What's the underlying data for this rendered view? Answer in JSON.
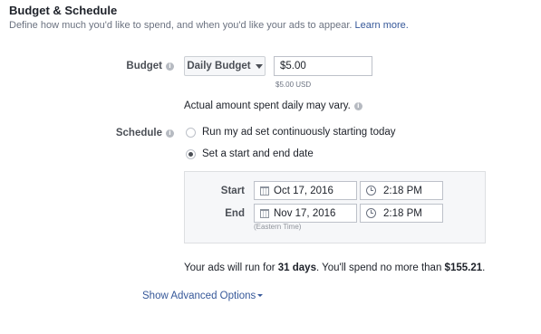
{
  "section": {
    "title": "Budget & Schedule",
    "subtitle": "Define how much you'd like to spend, and when you'd like your ads to appear.",
    "learn_more": "Learn more."
  },
  "budget": {
    "label": "Budget",
    "type_selected": "Daily Budget",
    "amount": "$5.00",
    "currency_hint": "$5.00 USD",
    "note": "Actual amount spent daily may vary."
  },
  "schedule": {
    "label": "Schedule",
    "options": [
      {
        "label": "Run my ad set continuously starting today",
        "selected": false
      },
      {
        "label": "Set a start and end date",
        "selected": true
      }
    ],
    "start": {
      "label": "Start",
      "date": "Oct 17, 2016",
      "time": "2:18 PM"
    },
    "end": {
      "label": "End",
      "date": "Nov 17, 2016",
      "time": "2:18 PM"
    },
    "timezone": "(Eastern Time)"
  },
  "summary": {
    "prefix": "Your ads will run for ",
    "days": "31 days",
    "middle": ". You'll spend no more than ",
    "amount": "$155.21",
    "suffix": "."
  },
  "advanced": {
    "label": "Show Advanced Options"
  },
  "colors": {
    "link": "#365899",
    "label": "#4b4f56",
    "panel_bg": "#f6f7f9"
  }
}
